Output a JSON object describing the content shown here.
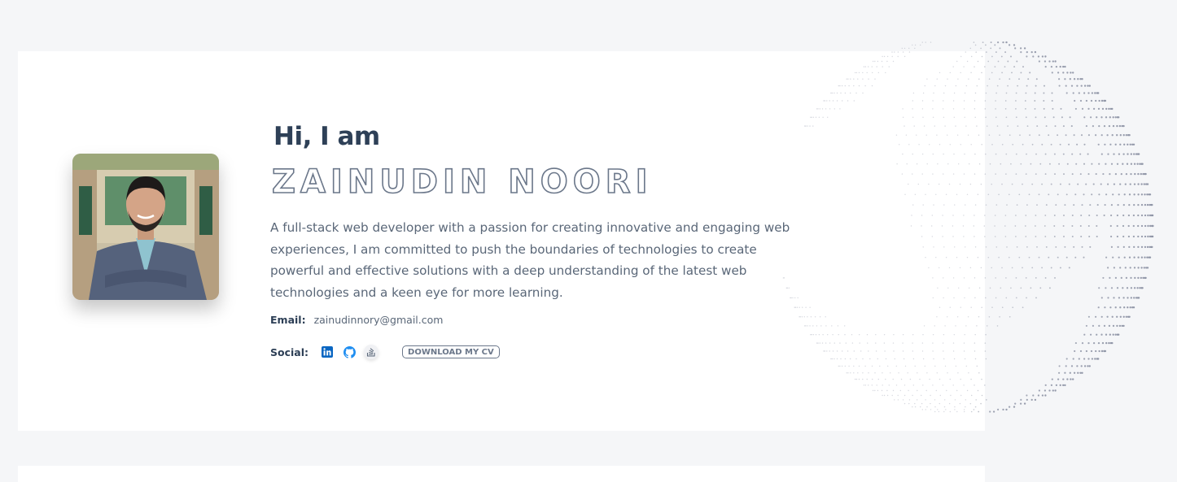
{
  "hero": {
    "greeting": "Hi, I am",
    "name": "ZAINUDIN NOORI",
    "bio": "A full-stack web developer with a passion for creating innovative and engaging web experiences, I am committed to push the boundaries of technologies to create powerful and effective solutions with a deep understanding of the latest web technologies and a keen eye for more learning.",
    "email_label": "Email:",
    "email": "zainudinnory@gmail.com",
    "social_label": "Social:",
    "social_icons": [
      "linkedin-icon",
      "github-icon",
      "stack-overflow-icon"
    ],
    "cv_button": "DOWNLOAD MY CV"
  },
  "colors": {
    "background": "#f5f6f8",
    "card": "#ffffff",
    "heading": "#2e4057",
    "outline_text": "#6b778a",
    "body_text": "#5a6778",
    "linkedin": "#0a66c2",
    "github": "#1f8ef1",
    "globe_dots": "#8a90a2"
  }
}
